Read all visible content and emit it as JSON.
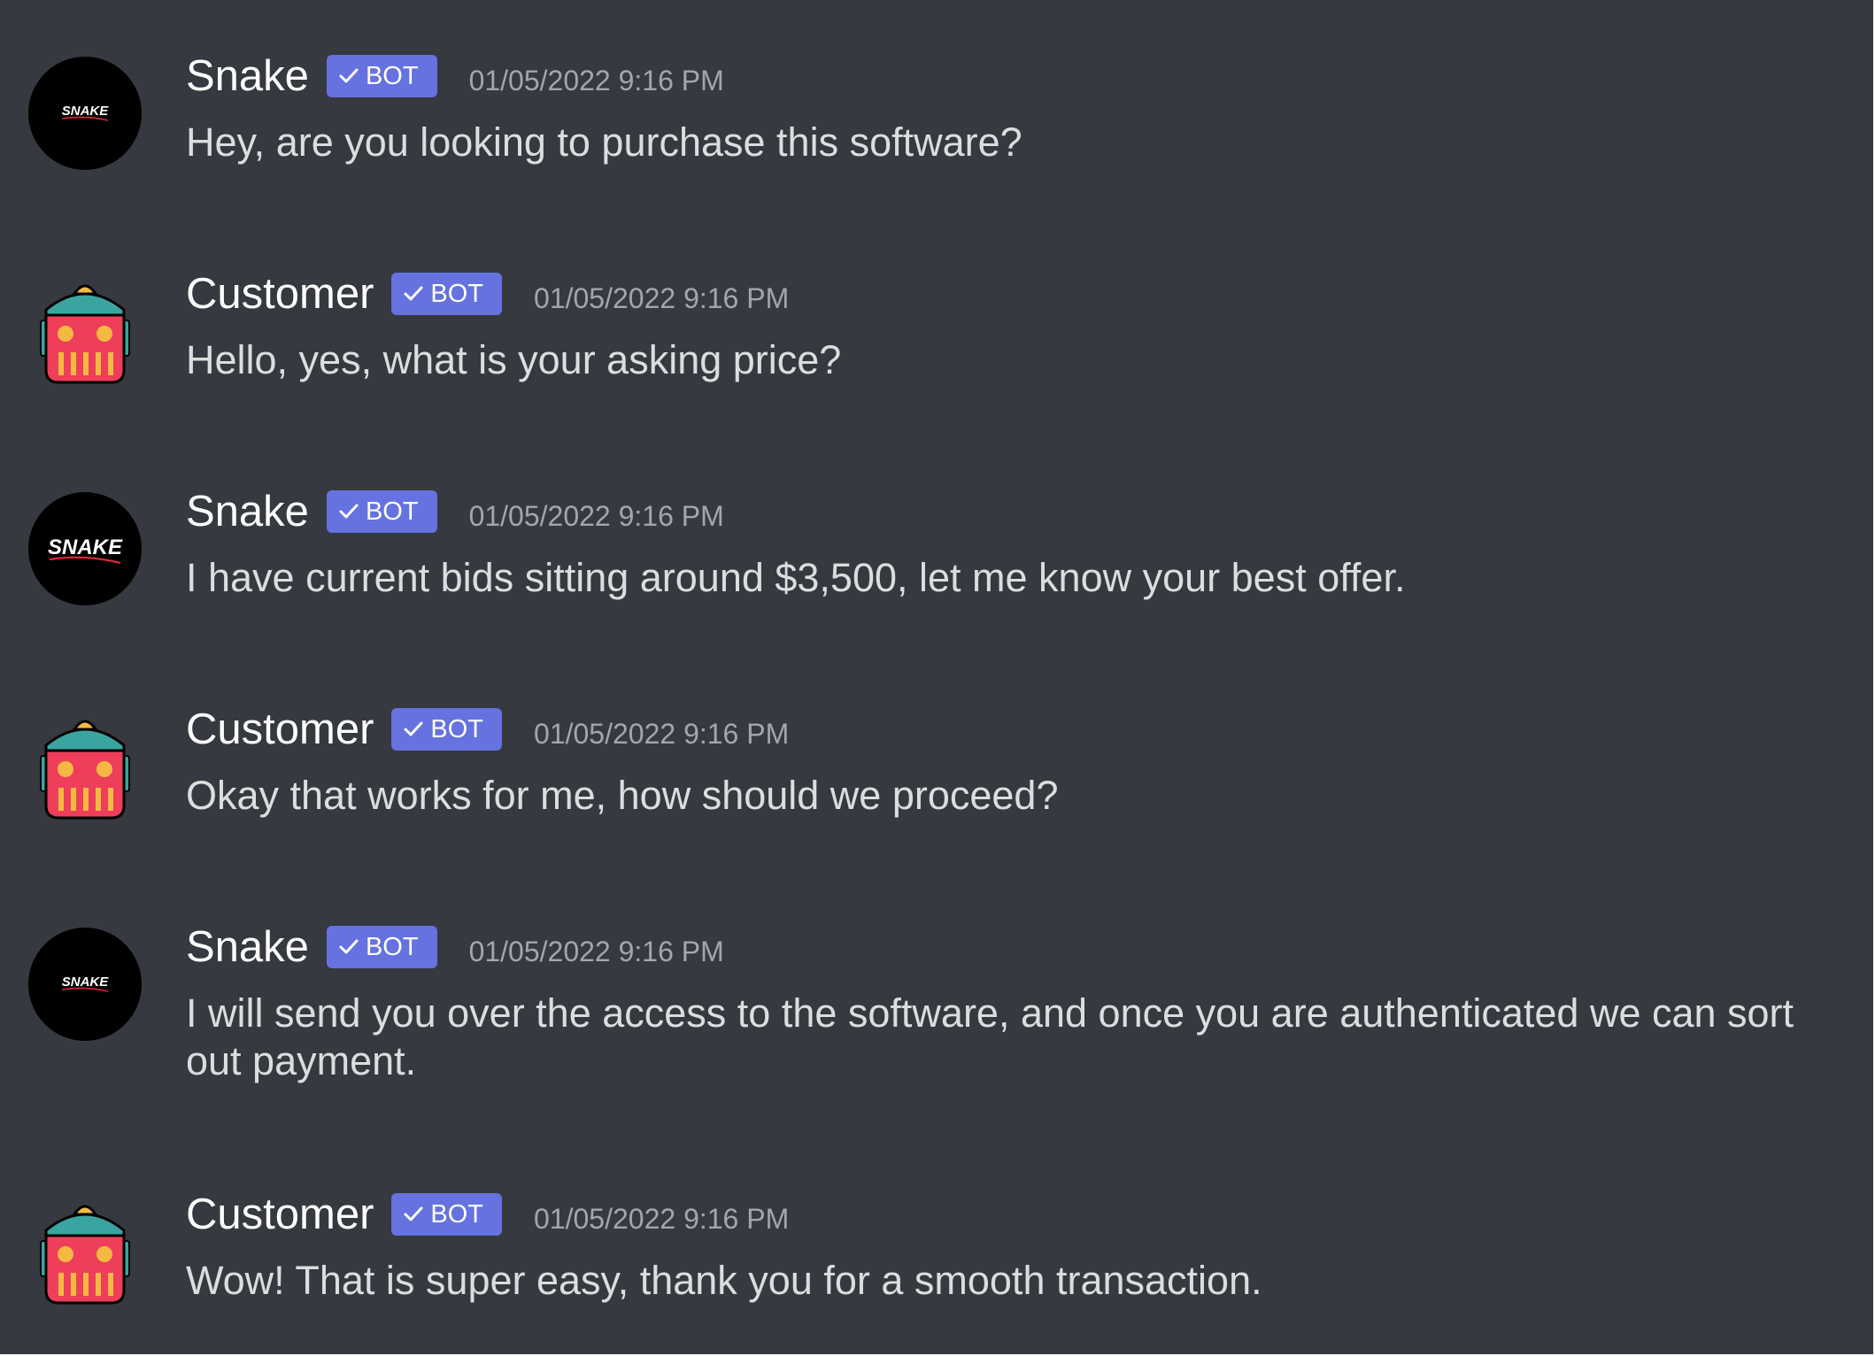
{
  "colors": {
    "background": "#36393f",
    "username": "#ffffff",
    "message_text": "#dcddde",
    "timestamp": "#a3a6aa",
    "bot_tag": "#6572e0",
    "customer_avatar_red": "#ee3e5a",
    "customer_avatar_teal": "#3aa5a0",
    "customer_avatar_yellow": "#f5b942",
    "snake_logo_accent": "#e0263a"
  },
  "messages": [
    {
      "author": "Snake",
      "avatar_icon": "snake-logo-icon",
      "avatar_text": "SNAKE",
      "tag": "BOT",
      "timestamp": "01/05/2022 9:16 PM",
      "text": "Hey, are you looking to purchase this software?"
    },
    {
      "author": "Customer",
      "avatar_icon": "robot-icon",
      "tag": "BOT",
      "timestamp": "01/05/2022 9:16 PM",
      "text": "Hello, yes, what is your asking price?"
    },
    {
      "author": "Snake",
      "avatar_icon": "snake-logo-icon",
      "avatar_text": "SNAKE",
      "tag": "BOT",
      "timestamp": "01/05/2022 9:16 PM",
      "text": "I have current bids sitting around $3,500, let me know your best offer."
    },
    {
      "author": "Customer",
      "avatar_icon": "robot-icon",
      "tag": "BOT",
      "timestamp": "01/05/2022 9:16 PM",
      "text": "Okay that works for me, how should we proceed?"
    },
    {
      "author": "Snake",
      "avatar_icon": "snake-logo-icon",
      "avatar_text": "SNAKE",
      "tag": "BOT",
      "timestamp": "01/05/2022 9:16 PM",
      "text": "I will send you over the access to the software, and once you are authenticated we can sort out payment."
    },
    {
      "author": "Customer",
      "avatar_icon": "robot-icon",
      "tag": "BOT",
      "timestamp": "01/05/2022 9:16 PM",
      "text": "Wow! That is super easy, thank you for a smooth transaction."
    }
  ]
}
